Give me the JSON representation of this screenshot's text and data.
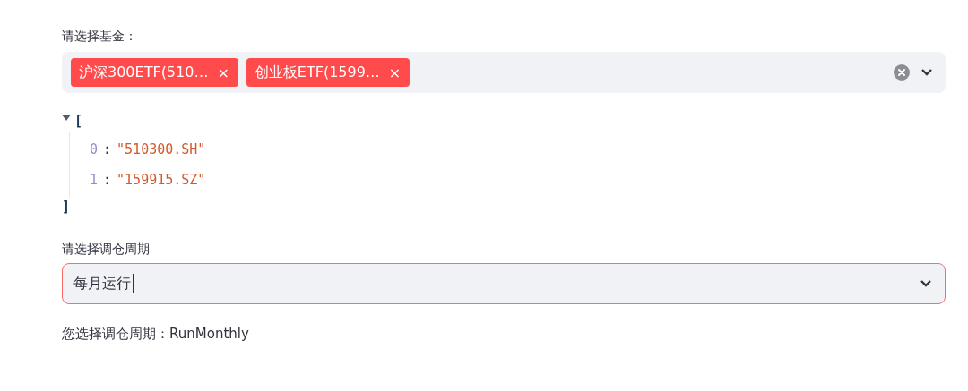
{
  "fund_select": {
    "label": "请选择基金：",
    "tags": [
      {
        "label": "沪深300ETF(510…",
        "remove": "×"
      },
      {
        "label": "创业板ETF(1599…",
        "remove": "×"
      }
    ]
  },
  "json_view": {
    "expanded": true,
    "open": "[",
    "close": "]",
    "items": [
      {
        "index": "0",
        "separator": ":",
        "value": "\"510300.SH\""
      },
      {
        "index": "1",
        "separator": ":",
        "value": "\"159915.SZ\""
      }
    ]
  },
  "period_select": {
    "label": "请选择调仓周期",
    "value": "每月运行",
    "focused": true
  },
  "result": {
    "text": "您选择调仓周期：RunMonthly"
  }
}
